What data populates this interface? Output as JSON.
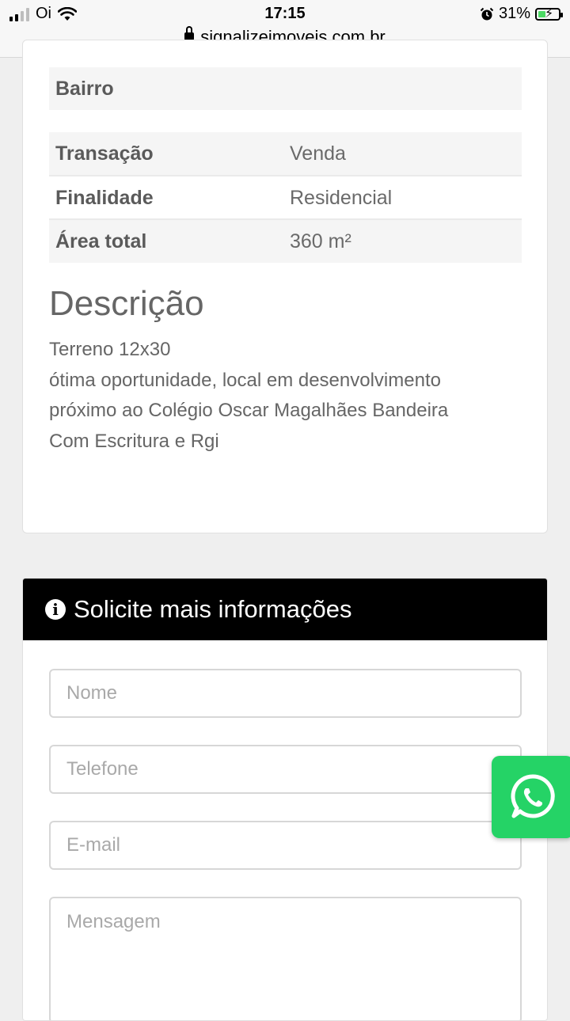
{
  "status_bar": {
    "carrier": "Oi",
    "time": "17:15",
    "battery_percent": "31%",
    "url": "signalizeimoveis.com.br"
  },
  "details": {
    "bairro_label": "Bairro",
    "rows": [
      {
        "label": "Transação",
        "value": "Venda"
      },
      {
        "label": "Finalidade",
        "value": "Residencial"
      },
      {
        "label": "Área total",
        "value": "360 m²"
      }
    ]
  },
  "description": {
    "title": "Descrição",
    "lines": [
      "Terreno 12x30",
      "ótima oportunidade, local em desenvolvimento",
      "próximo ao Colégio Oscar Magalhães Bandeira",
      "Com Escritura e Rgi"
    ]
  },
  "form": {
    "title": "Solicite mais informações",
    "name_placeholder": "Nome",
    "phone_placeholder": "Telefone",
    "email_placeholder": "E-mail",
    "message_placeholder": "Mensagem"
  },
  "icons": {
    "whatsapp": "whatsapp-icon",
    "info": "info-icon",
    "lock": "lock-icon",
    "wifi": "wifi-icon",
    "alarm": "alarm-icon",
    "battery": "battery-icon"
  },
  "colors": {
    "form_header_bg": "#000000",
    "whatsapp_green": "#25d366",
    "battery_fill": "#4cd964"
  }
}
